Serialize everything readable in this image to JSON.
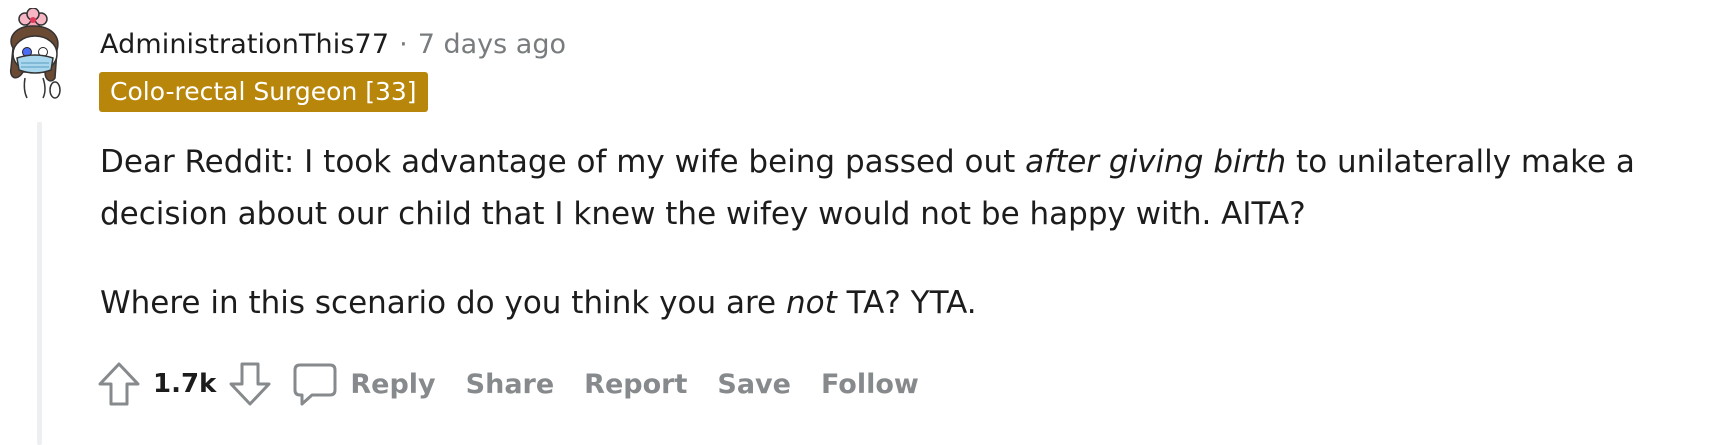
{
  "comment": {
    "author": "AdministrationThis77",
    "separator": "·",
    "timestamp": "7 days ago",
    "flair": {
      "text": "Colo-rectal Surgeon [33]",
      "color": "#b8860b"
    },
    "avatar_icon": "snoo-avatar-icon",
    "body": {
      "p1_pre": "Dear Reddit: I took advantage of my wife being passed out ",
      "p1_em": "after giving birth",
      "p1_post": " to unilaterally make a decision about our child that I knew the wifey would not be happy with. AITA?",
      "p2_pre": "Where in this scenario do you think you are ",
      "p2_em": "not",
      "p2_post": " TA? YTA."
    },
    "score": "1.7k",
    "actions": {
      "upvote_icon": "upvote-arrow-icon",
      "downvote_icon": "downvote-arrow-icon",
      "reply_icon": "speech-bubble-icon",
      "reply": "Reply",
      "share": "Share",
      "report": "Report",
      "save": "Save",
      "follow": "Follow"
    }
  },
  "colors": {
    "text": "#1c1c1c",
    "muted": "#787c7e",
    "action": "#878a8c",
    "thread_line": "#edeff1"
  }
}
